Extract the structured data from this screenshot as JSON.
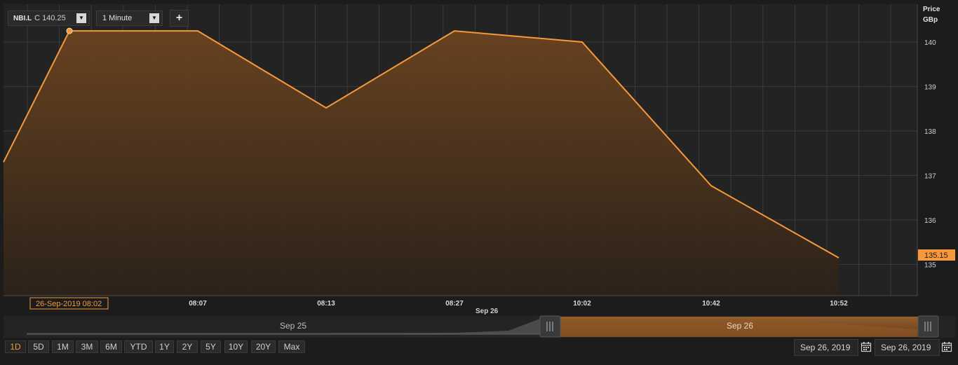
{
  "header": {
    "symbol": "NBI.L",
    "close_prefix": "C",
    "close_value": "140.25",
    "interval": "1 Minute",
    "add_label": "+"
  },
  "axis": {
    "y_title_line1": "Price",
    "y_title_line2": "GBp",
    "current_price_label": "135.15",
    "cursor_date_label": "26-Sep-2019 08:02",
    "x_date_label": "Sep 26"
  },
  "navigator": {
    "left_label": "Sep 25",
    "right_label": "Sep 26"
  },
  "ranges": [
    "1D",
    "5D",
    "1M",
    "3M",
    "6M",
    "YTD",
    "1Y",
    "2Y",
    "5Y",
    "10Y",
    "20Y",
    "Max"
  ],
  "active_range": "1D",
  "dates": {
    "from": "Sep 26, 2019",
    "to": "Sep 26, 2019"
  },
  "colors": {
    "accent": "#f7993a",
    "background": "#1c1c1c",
    "plot_background": "#232323",
    "grid": "#3a3a3a"
  },
  "chart_data": {
    "type": "area",
    "x_tick_labels": [
      "08:07",
      "08:13",
      "08:27",
      "10:02",
      "10:42",
      "10:52"
    ],
    "y_ticks": [
      135,
      136,
      137,
      138,
      139,
      140
    ],
    "ylim": [
      134.3,
      140.85
    ],
    "grid": true,
    "points": [
      {
        "x": "before 08:02",
        "y": 137.3
      },
      {
        "x": "08:02",
        "y": 140.25
      },
      {
        "x": "08:07",
        "y": 140.25
      },
      {
        "x": "08:13",
        "y": 138.52
      },
      {
        "x": "08:27",
        "y": 140.25
      },
      {
        "x": "10:02",
        "y": 140.0
      },
      {
        "x": "10:42",
        "y": 136.77
      },
      {
        "x": "10:52",
        "y": 135.15
      }
    ],
    "highlighted_point": {
      "x": "08:02",
      "y": 140.25
    }
  }
}
